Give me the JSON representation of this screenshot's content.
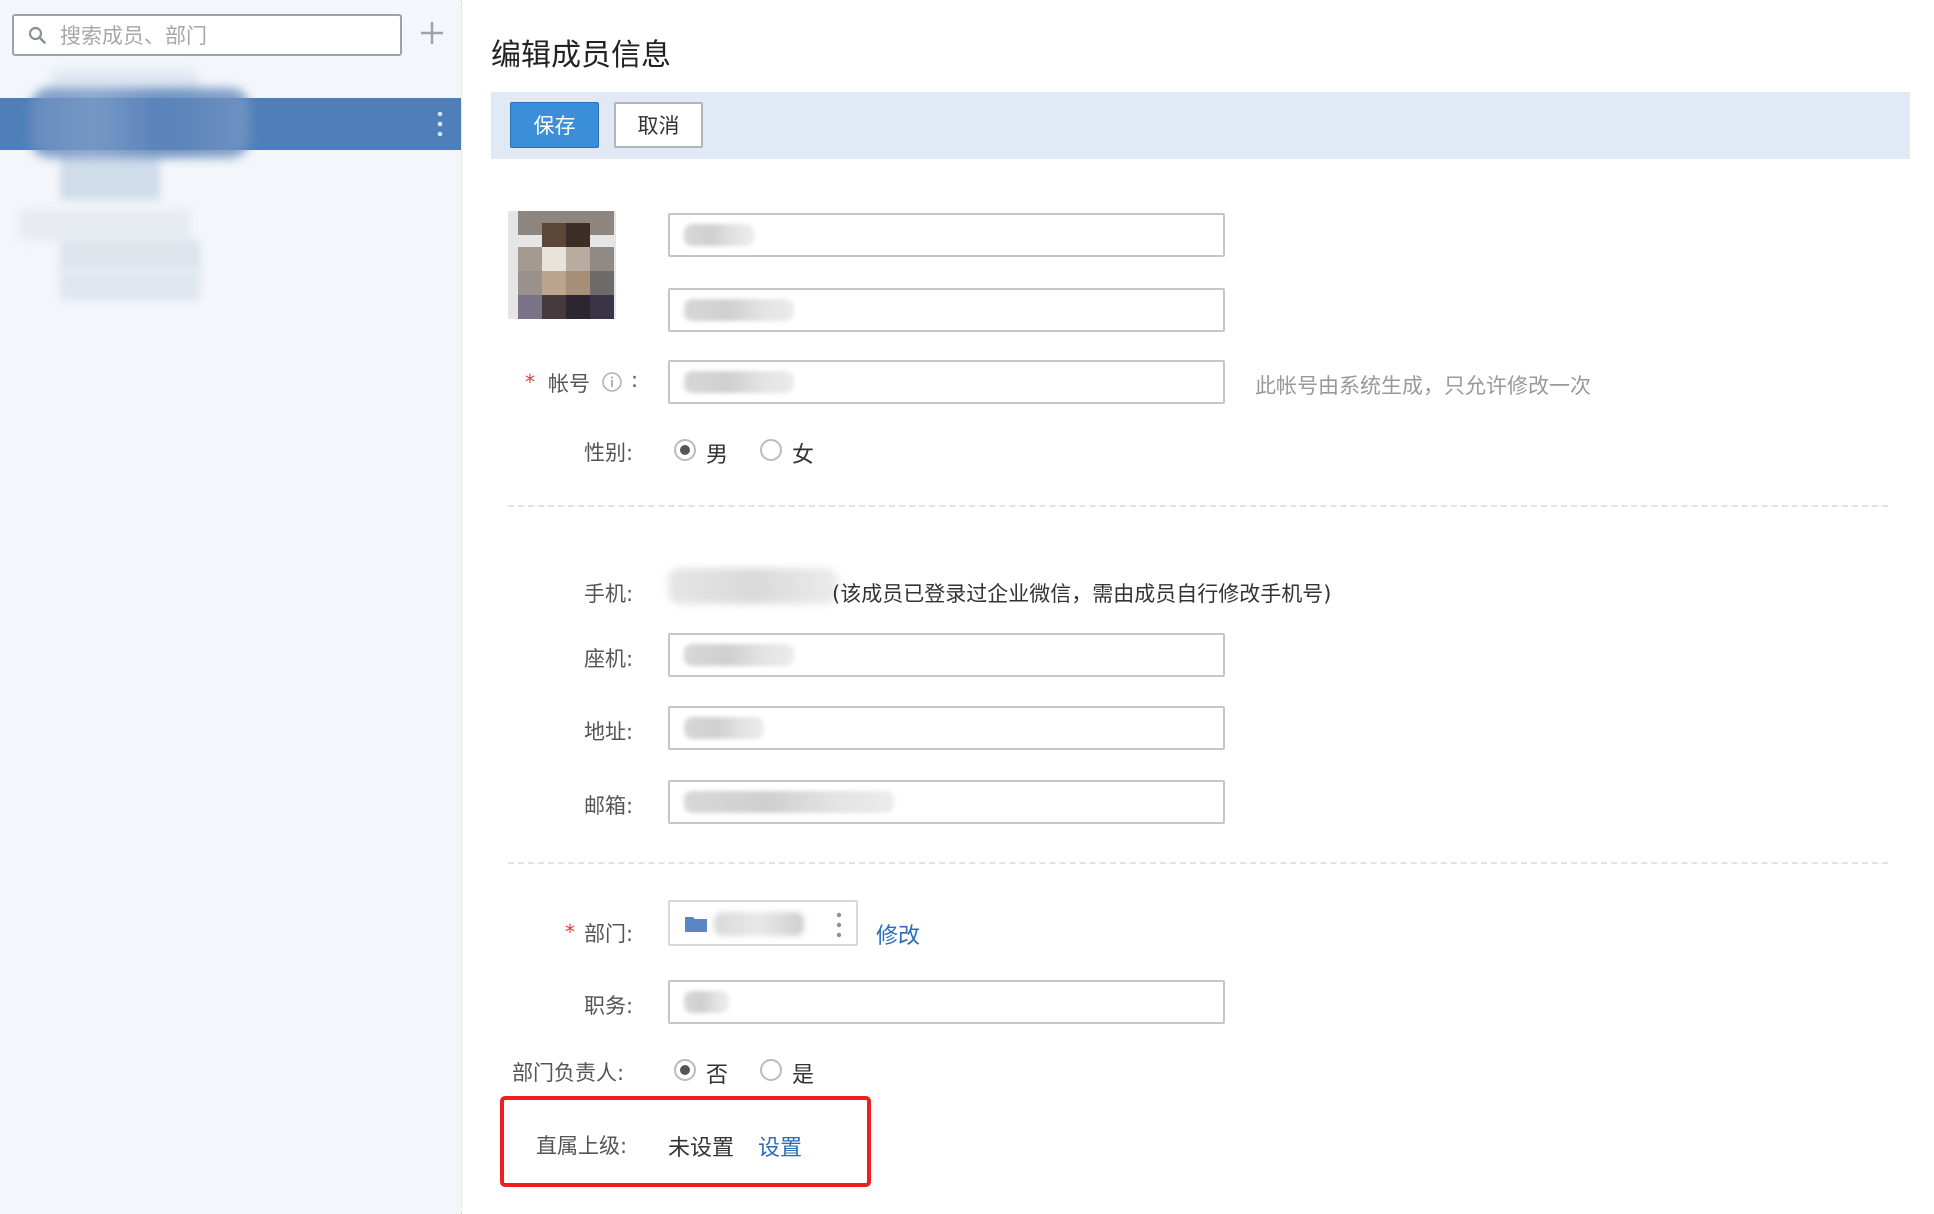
{
  "sidebar": {
    "search_placeholder": "搜索成员、部门"
  },
  "page": {
    "title": "编辑成员信息"
  },
  "toolbar": {
    "save_label": "保存",
    "cancel_label": "取消"
  },
  "form": {
    "account_label": "帐号",
    "account_hint": "此帐号由系统生成，只允许修改一次",
    "gender_label": "性别:",
    "gender_options": [
      "男",
      "女"
    ],
    "gender_selected": "男",
    "mobile_label": "手机:",
    "mobile_note": "(该成员已登录过企业微信，需由成员自行修改手机号)",
    "landline_label": "座机:",
    "address_label": "地址:",
    "email_label": "邮箱:",
    "department_label": "部门:",
    "department_modify_link": "修改",
    "position_label": "职务:",
    "dept_head_label": "部门负责人:",
    "dept_head_options": [
      "否",
      "是"
    ],
    "dept_head_selected": "否",
    "supervisor_label": "直属上级:",
    "supervisor_value": "未设置",
    "supervisor_set_link": "设置"
  },
  "colors": {
    "primary": "#3b8fd8",
    "toolbar_bg": "#e1e9f4",
    "sidebar_selected": "#4f7fb8",
    "link": "#2b6cb8",
    "required": "#e23a3a",
    "highlight_border": "#f01f1f"
  }
}
